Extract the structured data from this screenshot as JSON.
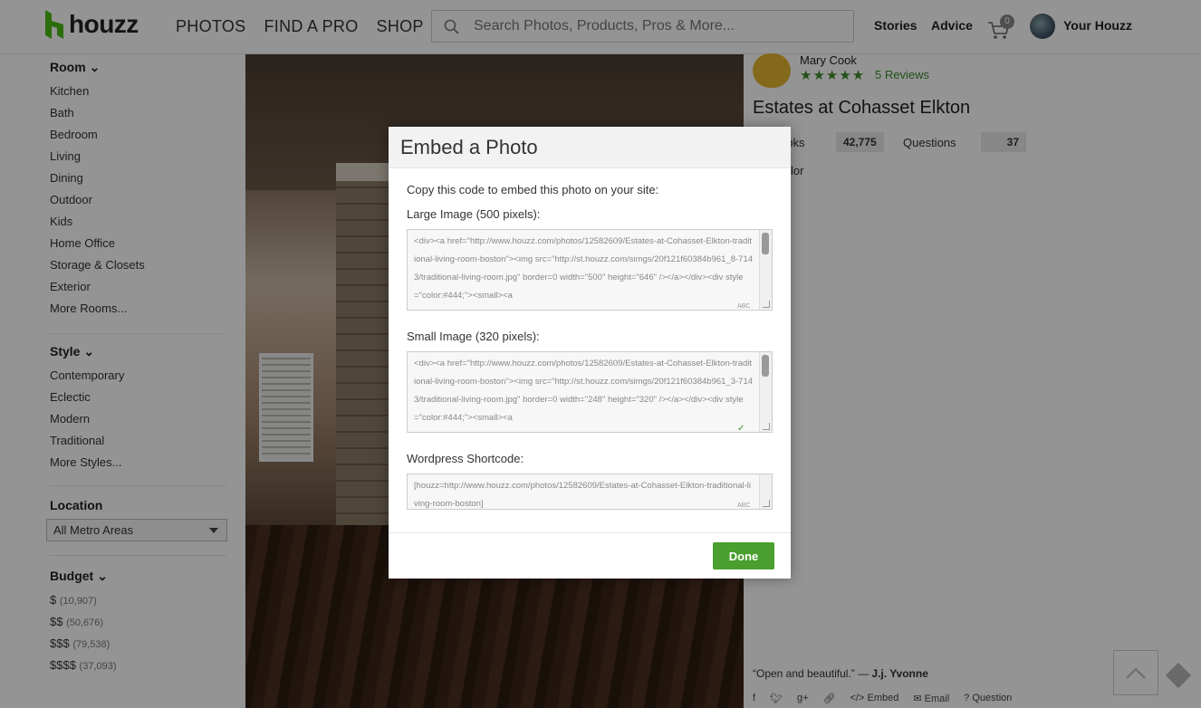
{
  "header": {
    "logo_text": "houzz",
    "nav": [
      "PHOTOS",
      "FIND A PRO",
      "SHOP"
    ],
    "search_placeholder": "Search Photos, Products, Pros & More...",
    "stories": "Stories",
    "advice": "Advice",
    "cart_count": "0",
    "your_houzz": "Your Houzz"
  },
  "sidebar": {
    "room": {
      "heading": "Room",
      "items": [
        "Kitchen",
        "Bath",
        "Bedroom",
        "Living",
        "Dining",
        "Outdoor",
        "Kids",
        "Home Office",
        "Storage & Closets",
        "Exterior",
        "More Rooms..."
      ]
    },
    "style": {
      "heading": "Style",
      "items": [
        "Contemporary",
        "Eclectic",
        "Modern",
        "Traditional",
        "More Styles..."
      ]
    },
    "location": {
      "heading": "Location",
      "selected": "All Metro Areas"
    },
    "budget": {
      "heading": "Budget",
      "items": [
        {
          "label": "$",
          "count": "(10,907)"
        },
        {
          "label": "$$",
          "count": "(50,676)"
        },
        {
          "label": "$$$",
          "count": "(79,538)"
        },
        {
          "label": "$$$$",
          "count": "(37,093)"
        }
      ]
    }
  },
  "panel": {
    "pro_name": "Mary Cook",
    "stars": "★★★★★",
    "reviews": "5 Reviews",
    "title": "Estates at Cohasset Elkton",
    "ideabooks_label": "ooks",
    "ideabooks_value": "42,775",
    "questions_label": "Questions",
    "questions_value": "37",
    "color_label": "lor",
    "quote_text": "“Open and beautiful.” — ",
    "quote_author": "J.j. Yvonne",
    "actions": {
      "embed": "Embed",
      "email": "Email",
      "question": "Question"
    }
  },
  "modal": {
    "title": "Embed a Photo",
    "intro": "Copy this code to embed this photo on your site:",
    "large_label": "Large Image (500 pixels):",
    "large_code": "<div><a href=\"http://www.houzz.com/photos/12582609/Estates-at-Cohasset-Elkton-traditional-living-room-boston\"><img src=\"http://st.houzz.com/simgs/20f121f60384b961_8-7143/traditional-living-room.jpg\" border=0 width=\"500\" height=\"646\" /></a></div><div style=\"color:#444;\"><small><a",
    "small_label": "Small Image (320 pixels):",
    "small_code": "<div><a href=\"http://www.houzz.com/photos/12582609/Estates-at-Cohasset-Elkton-traditional-living-room-boston\"><img src=\"http://st.houzz.com/simgs/20f121f60384b961_3-7143/traditional-living-room.jpg\" border=0 width=\"248\" height=\"320\" /></a></div><div style=\"color:#444;\"><small><a",
    "wp_label": "Wordpress Shortcode:",
    "wp_code": "[houzz=http://www.houzz.com/photos/12582609/Estates-at-Cohasset-Elkton-traditional-living-room-boston]",
    "done": "Done"
  },
  "colors": {
    "brand_green": "#4a9f2e",
    "star_green": "#3d8b2b"
  }
}
